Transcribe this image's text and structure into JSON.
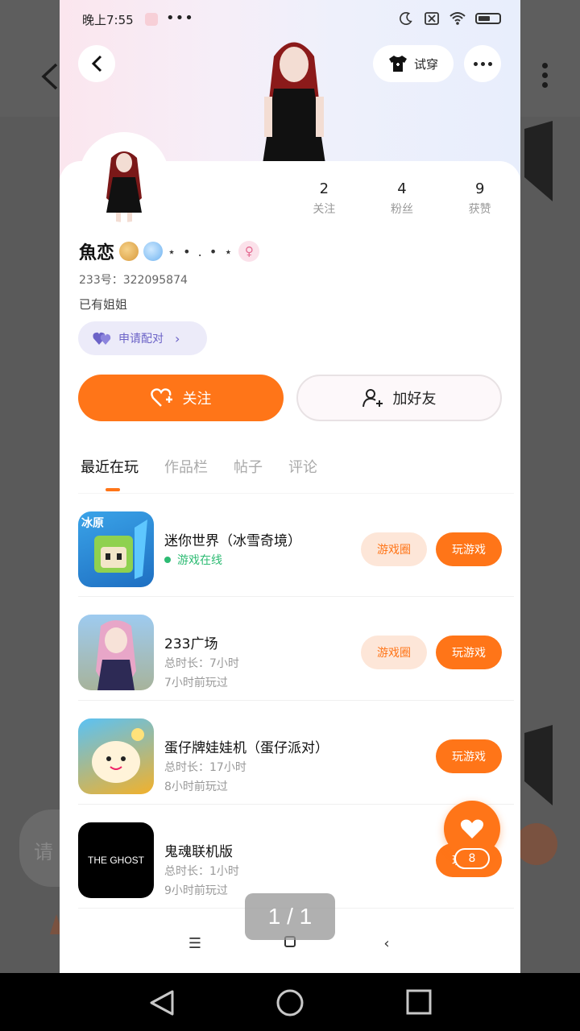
{
  "status": {
    "time": "晚上7:55",
    "dots": "•••",
    "battery": "47"
  },
  "header": {
    "tryon_label": "试穿"
  },
  "profile": {
    "name": "魚恋",
    "name_suffix": "⋆ • . • ⋆",
    "uid": "233号：322095874",
    "bio": "已有姐姐",
    "pair_label": "申请配对",
    "stats": [
      {
        "num": "2",
        "label": "关注"
      },
      {
        "num": "4",
        "label": "粉丝"
      },
      {
        "num": "9",
        "label": "获赞"
      }
    ]
  },
  "actions": {
    "follow_label": "关注",
    "add_friend_label": "加好友"
  },
  "tabs": [
    "最近在玩",
    "作品栏",
    "帖子",
    "评论"
  ],
  "games": [
    {
      "title": "迷你世界（冰雪奇境）",
      "sub1": "游戏在线",
      "sub2": "",
      "circle": "游戏圈",
      "play": "玩游戏",
      "icon_text": "冰原"
    },
    {
      "title": "233广场",
      "sub1": "总时长：7小时",
      "sub2": "7小时前玩过",
      "circle": "游戏圈",
      "play": "玩游戏",
      "icon_text": ""
    },
    {
      "title": "蛋仔牌娃娃机（蛋仔派对）",
      "sub1": "总时长：17小时",
      "sub2": "8小时前玩过",
      "circle": "",
      "play": "玩游戏",
      "icon_text": ""
    },
    {
      "title": "鬼魂联机版",
      "sub1": "总时长：1小时",
      "sub2": "9小时前玩过",
      "circle": "",
      "play": "玩游戏",
      "icon_text": "THE GHOST"
    }
  ],
  "fab": {
    "count": "8"
  },
  "viewer": {
    "page": "1 / 1"
  },
  "background": {
    "input_hint": "请"
  },
  "colors": {
    "accent": "#ff7518",
    "pair": "#6c63c7",
    "online": "#2dbb73"
  }
}
